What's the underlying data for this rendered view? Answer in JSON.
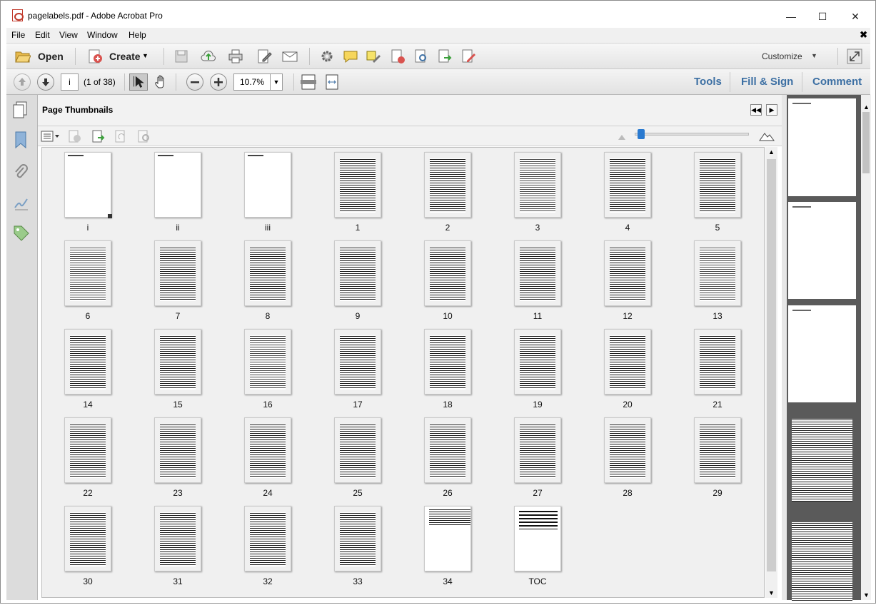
{
  "window": {
    "title": "pagelabels.pdf - Adobe Acrobat Pro",
    "minimize": "—",
    "maximize": "☐",
    "close": "✕"
  },
  "menu": {
    "items": [
      "File",
      "Edit",
      "View",
      "Window",
      "Help"
    ],
    "close": "✖"
  },
  "toolbar": {
    "open_label": "Open",
    "create_label": "Create",
    "customize_label": "Customize"
  },
  "navbar": {
    "page_value": "i",
    "page_count": "(1 of 38)",
    "zoom_value": "10.7%"
  },
  "tasks": {
    "tools": "Tools",
    "fill_sign": "Fill & Sign",
    "comment": "Comment"
  },
  "panel": {
    "title": "Page Thumbnails"
  },
  "thumbnails": [
    {
      "label": "i",
      "kind": "blank"
    },
    {
      "label": "ii",
      "kind": "blank"
    },
    {
      "label": "iii",
      "kind": "blank"
    },
    {
      "label": "1",
      "kind": "txt"
    },
    {
      "label": "2",
      "kind": "txt"
    },
    {
      "label": "3",
      "kind": "txt light"
    },
    {
      "label": "4",
      "kind": "txt"
    },
    {
      "label": "5",
      "kind": "txt"
    },
    {
      "label": "6",
      "kind": "txt light"
    },
    {
      "label": "7",
      "kind": "txt"
    },
    {
      "label": "8",
      "kind": "txt"
    },
    {
      "label": "9",
      "kind": "txt"
    },
    {
      "label": "10",
      "kind": "txt"
    },
    {
      "label": "11",
      "kind": "txt"
    },
    {
      "label": "12",
      "kind": "txt"
    },
    {
      "label": "13",
      "kind": "txt light"
    },
    {
      "label": "14",
      "kind": "txt"
    },
    {
      "label": "15",
      "kind": "txt"
    },
    {
      "label": "16",
      "kind": "txt light"
    },
    {
      "label": "17",
      "kind": "txt"
    },
    {
      "label": "18",
      "kind": "txt"
    },
    {
      "label": "19",
      "kind": "txt"
    },
    {
      "label": "20",
      "kind": "txt"
    },
    {
      "label": "21",
      "kind": "txt"
    },
    {
      "label": "22",
      "kind": "txt"
    },
    {
      "label": "23",
      "kind": "txt"
    },
    {
      "label": "24",
      "kind": "txt"
    },
    {
      "label": "25",
      "kind": "txt"
    },
    {
      "label": "26",
      "kind": "txt"
    },
    {
      "label": "27",
      "kind": "txt"
    },
    {
      "label": "28",
      "kind": "txt"
    },
    {
      "label": "29",
      "kind": "txt"
    },
    {
      "label": "30",
      "kind": "txt"
    },
    {
      "label": "31",
      "kind": "txt"
    },
    {
      "label": "32",
      "kind": "txt"
    },
    {
      "label": "33",
      "kind": "txt"
    },
    {
      "label": "34",
      "kind": "partial"
    },
    {
      "label": "TOC",
      "kind": "toc"
    }
  ],
  "colors": {
    "link": "#3c6fa3",
    "selection_knob": "#2a7ad0",
    "pdf_red": "#c0392b"
  }
}
